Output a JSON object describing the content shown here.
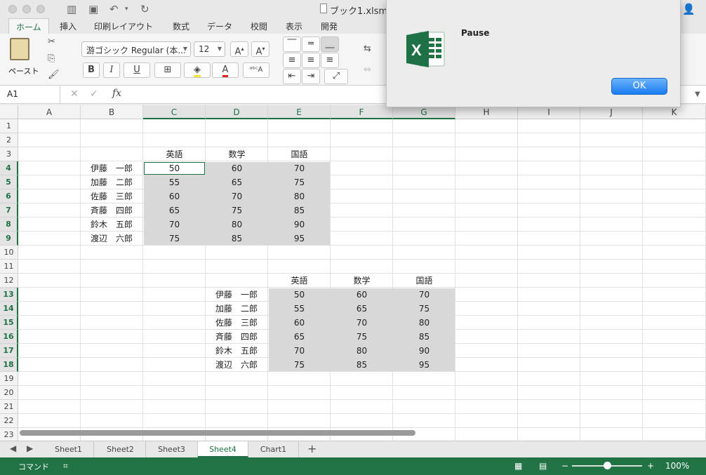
{
  "window": {
    "title": "ブック1.xlsm"
  },
  "ribbon": {
    "tabs": [
      "ホーム",
      "挿入",
      "印刷レイアウト",
      "数式",
      "データ",
      "校閲",
      "表示",
      "開発"
    ],
    "paste_label": "ペースト",
    "font_name": "游ゴシック Regular (本...",
    "font_size": "12",
    "bold": "B",
    "italic": "I",
    "underline": "U"
  },
  "formula_bar": {
    "name_box": "A1",
    "fx": "fx",
    "value": ""
  },
  "grid": {
    "columns": [
      "A",
      "B",
      "C",
      "D",
      "E",
      "F",
      "G",
      "H",
      "I",
      "J",
      "K"
    ],
    "rows": [
      "1",
      "2",
      "3",
      "4",
      "5",
      "6",
      "7",
      "8",
      "9",
      "10",
      "11",
      "12",
      "13",
      "14",
      "15",
      "16",
      "17",
      "18",
      "19",
      "20",
      "21",
      "22",
      "23"
    ],
    "table1": {
      "headers": [
        "英語",
        "数学",
        "国語"
      ],
      "names": [
        "伊藤　一郎",
        "加藤　二郎",
        "佐藤　三郎",
        "斉藤　四郎",
        "鈴木　五郎",
        "渡辺　六郎"
      ],
      "values": [
        [
          "50",
          "60",
          "70"
        ],
        [
          "55",
          "65",
          "75"
        ],
        [
          "60",
          "70",
          "80"
        ],
        [
          "65",
          "75",
          "85"
        ],
        [
          "70",
          "80",
          "90"
        ],
        [
          "75",
          "85",
          "95"
        ]
      ]
    },
    "table2": {
      "headers": [
        "英語",
        "数学",
        "国語"
      ],
      "names": [
        "伊藤　一郎",
        "加藤　二郎",
        "佐藤　三郎",
        "斉藤　四郎",
        "鈴木　五郎",
        "渡辺　六郎"
      ],
      "values": [
        [
          "50",
          "60",
          "70"
        ],
        [
          "55",
          "65",
          "75"
        ],
        [
          "60",
          "70",
          "80"
        ],
        [
          "65",
          "75",
          "85"
        ],
        [
          "70",
          "80",
          "90"
        ],
        [
          "75",
          "85",
          "95"
        ]
      ]
    }
  },
  "sheets": [
    "Sheet1",
    "Sheet2",
    "Sheet3",
    "Sheet4",
    "Chart1"
  ],
  "active_sheet": "Sheet4",
  "status": {
    "mode": "コマンド",
    "zoom": "100%"
  },
  "dialog": {
    "message": "Pause",
    "ok_label": "OK"
  },
  "colors": {
    "excel_green": "#217346",
    "ok_blue": "#1a7cf1"
  }
}
